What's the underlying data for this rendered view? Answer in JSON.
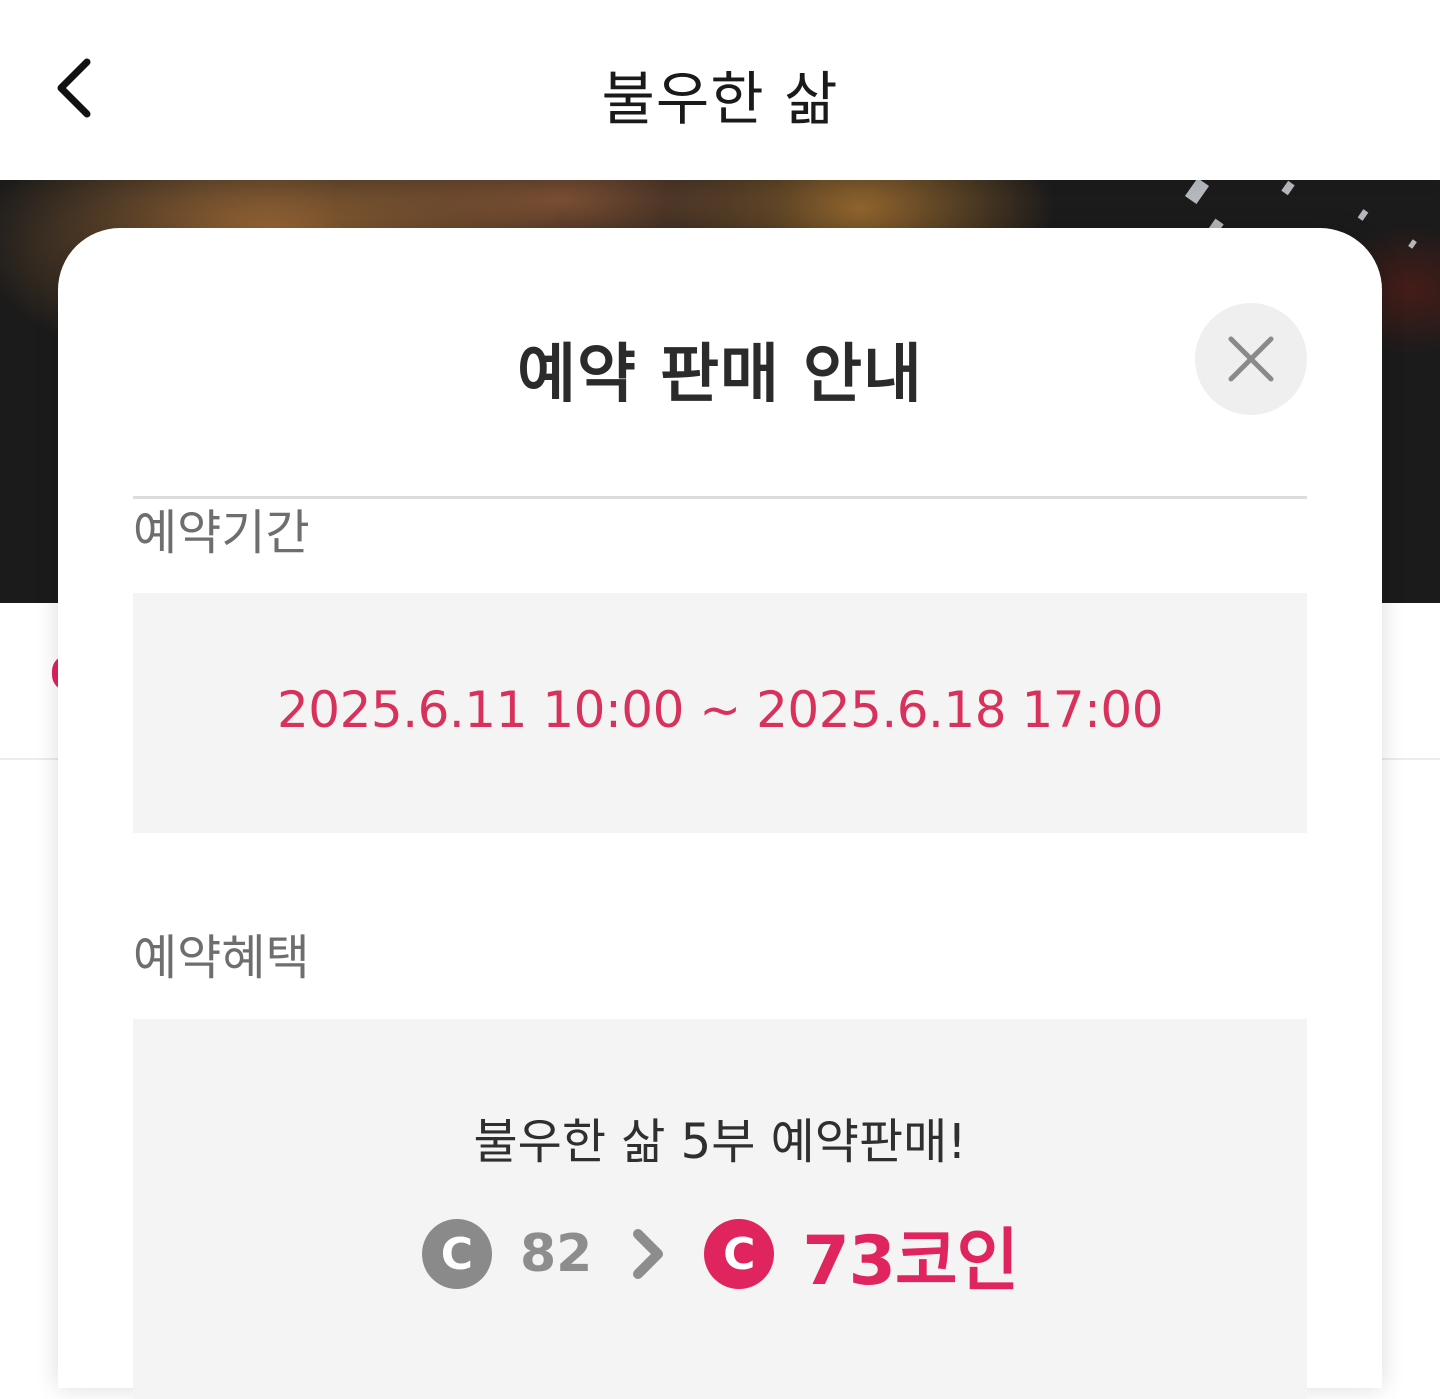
{
  "header": {
    "title": "불우한 삶"
  },
  "modal": {
    "title": "예약 판매 안내",
    "period": {
      "label": "예약기간",
      "value": "2025.6.11 10:00 ~ 2025.6.18 17:00"
    },
    "benefit": {
      "label": "예약혜택",
      "headline": "불우한 삶 5부 예약판매!",
      "coin_symbol": "C",
      "original_price": "82",
      "sale_price": "73코인"
    }
  },
  "colors": {
    "accent": "#e0245e",
    "period_text": "#d8315b",
    "coin_gray": "#8a8a8a",
    "box_bg": "#f4f4f4"
  },
  "icons": {
    "back": "chevron-left-icon",
    "close": "close-icon",
    "arrow": "chevron-right-icon",
    "coin": "coin-icon"
  }
}
